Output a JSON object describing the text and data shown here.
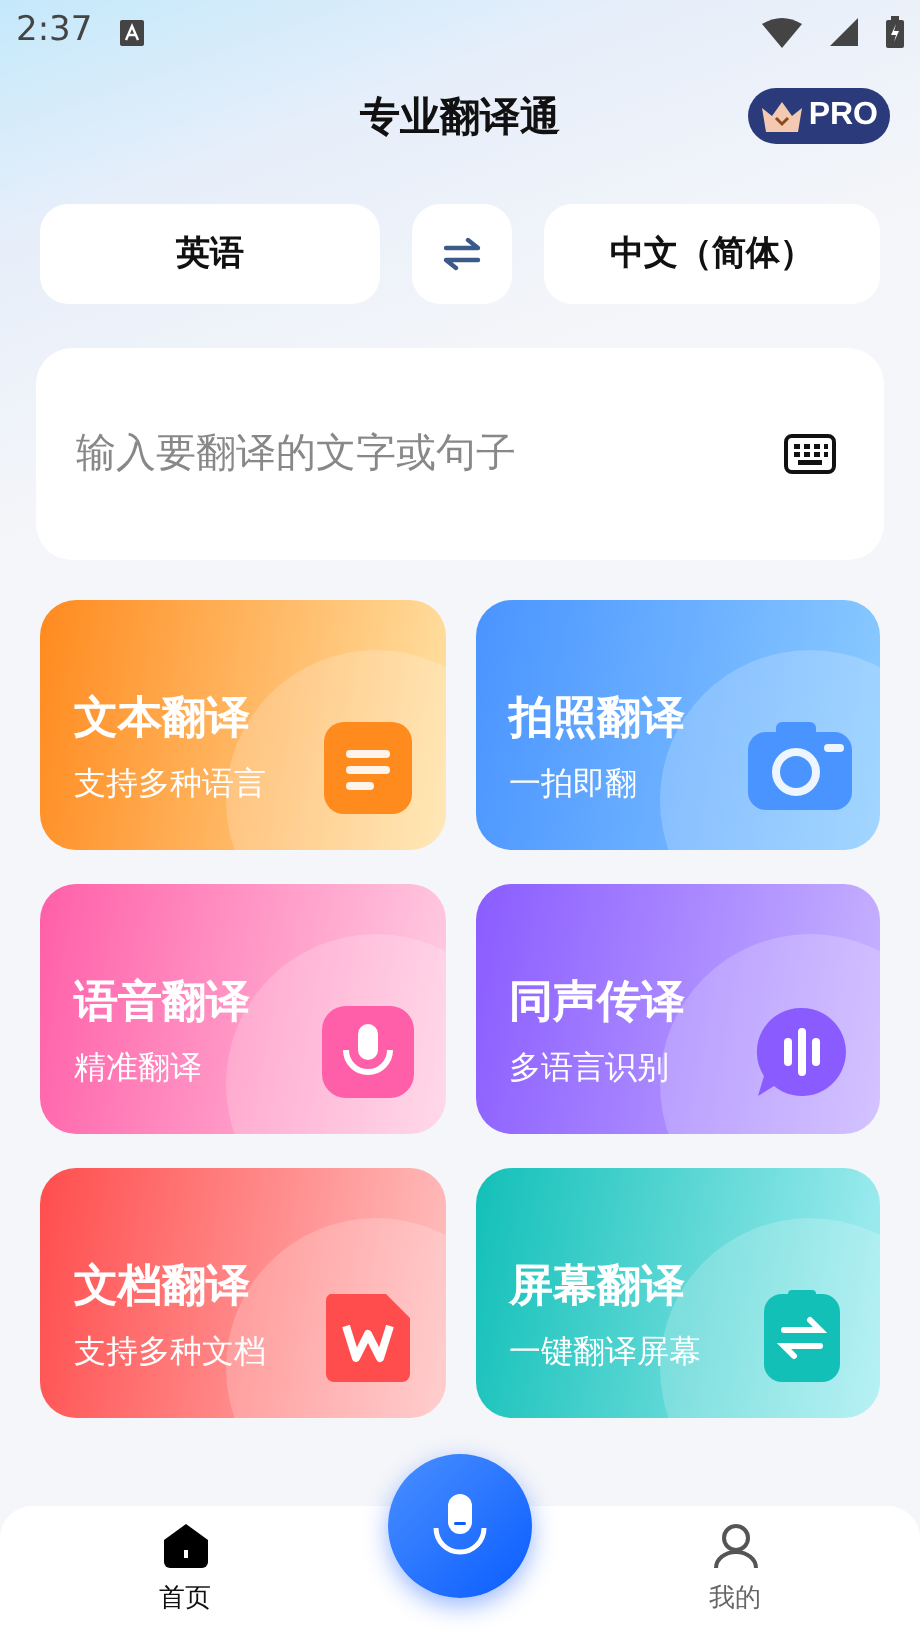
{
  "status_bar": {
    "time": "2:37"
  },
  "header": {
    "title": "专业翻译通",
    "badge": "PRO"
  },
  "languages": {
    "source": "英语",
    "target": "中文（简体）"
  },
  "input": {
    "placeholder": "输入要翻译的文字或句子"
  },
  "features": [
    {
      "kind": "text",
      "title": "文本翻译",
      "subtitle": "支持多种语言",
      "color": "#ff8a1e"
    },
    {
      "kind": "photo",
      "title": "拍照翻译",
      "subtitle": "一拍即翻",
      "color": "#4a94ff"
    },
    {
      "kind": "voice",
      "title": "语音翻译",
      "subtitle": "精准翻译",
      "color": "#ff5fa8"
    },
    {
      "kind": "simul",
      "title": "同声传译",
      "subtitle": "多语言识别",
      "color": "#8a5cff"
    },
    {
      "kind": "doc",
      "title": "文档翻译",
      "subtitle": "支持多种文档",
      "color": "#ff4d4d"
    },
    {
      "kind": "screen",
      "title": "屏幕翻译",
      "subtitle": "一键翻译屏幕",
      "color": "#12c0b8"
    }
  ],
  "nav": [
    {
      "label": "首页",
      "kind": "home",
      "selected": true
    },
    {
      "label": "我的",
      "kind": "profile",
      "selected": false
    }
  ]
}
